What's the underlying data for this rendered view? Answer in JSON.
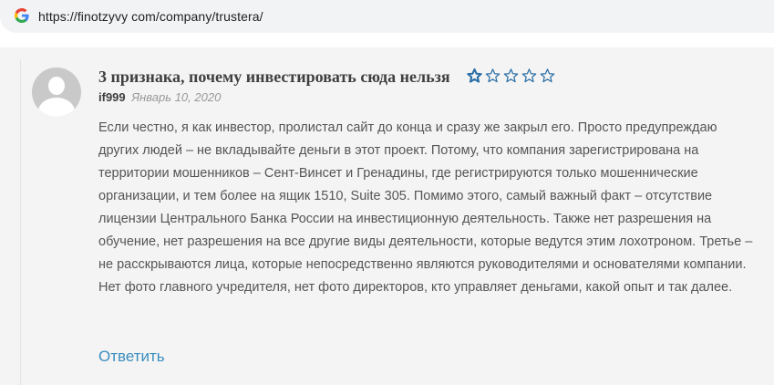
{
  "browser": {
    "url": "https://finotzyvy com/company/trustera/"
  },
  "comment": {
    "title": "3 признака, почему инвестировать сюда нельзя",
    "rating": {
      "value": 1,
      "max": 5
    },
    "author": "if999",
    "date": "Январь 10, 2020",
    "text": "Если честно, я как инвестор, пролистал сайт до конца и сразу же закрыл его. Просто предупреждаю других людей – не вкладывайте деньги в этот проект. Потому, что компания зарегистрирована на территории мошенников – Сент-Винсет и Гренадины, где регистрируются только мошеннические организации, и тем более на ящик 1510, Suite 305. Помимо этого, самый важный факт – отсутствие лицензии Центрального Банка России на инвестиционную деятельность. Также нет разрешения на обучение, нет разрешения на все другие виды деятельности, которые ведутся этим лохотроном. Третье – не расскрываются лица, которые непосредственно являются руководителями и основателями компании. Нет фото главного учредителя, нет фото директоров, кто управляет деньгами, какой опыт и так далее.",
    "reply_label": "Ответить"
  },
  "colors": {
    "star": "#2b6ea6",
    "reply_link": "#3a8dbf",
    "title": "#3f3f3f",
    "body_text": "#555555"
  }
}
